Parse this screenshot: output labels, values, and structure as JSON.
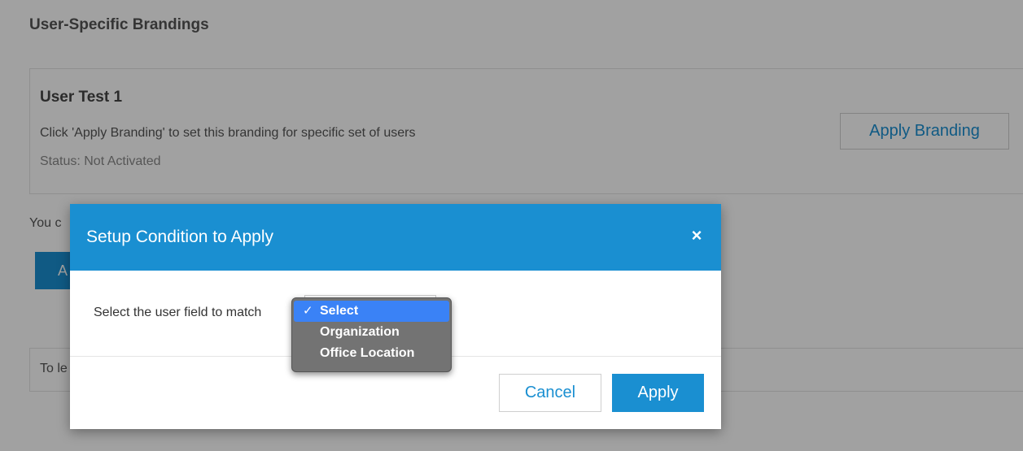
{
  "page": {
    "title": "User-Specific Brandings",
    "card": {
      "name": "User Test 1",
      "description": "Click 'Apply Branding' to set this branding for specific set of users",
      "status": "Status: Not Activated",
      "apply_branding_label": "Apply Branding"
    },
    "partial_text": "You c",
    "partial_button_label": "A",
    "partial_learn_text": "To le"
  },
  "modal": {
    "title": "Setup Condition to Apply",
    "close_icon": "close-icon",
    "field_label": "Select the user field to match",
    "dropdown": {
      "options": [
        {
          "label": "Select",
          "selected": true
        },
        {
          "label": "Organization",
          "selected": false
        },
        {
          "label": "Office Location",
          "selected": false
        }
      ],
      "check_glyph": "✓"
    },
    "cancel_label": "Cancel",
    "apply_label": "Apply"
  },
  "colors": {
    "accent": "#1a8fd1",
    "overlay": "rgba(0,0,0,0.37)",
    "dropdown_bg": "#737373",
    "dropdown_highlight": "#3a82f6"
  }
}
